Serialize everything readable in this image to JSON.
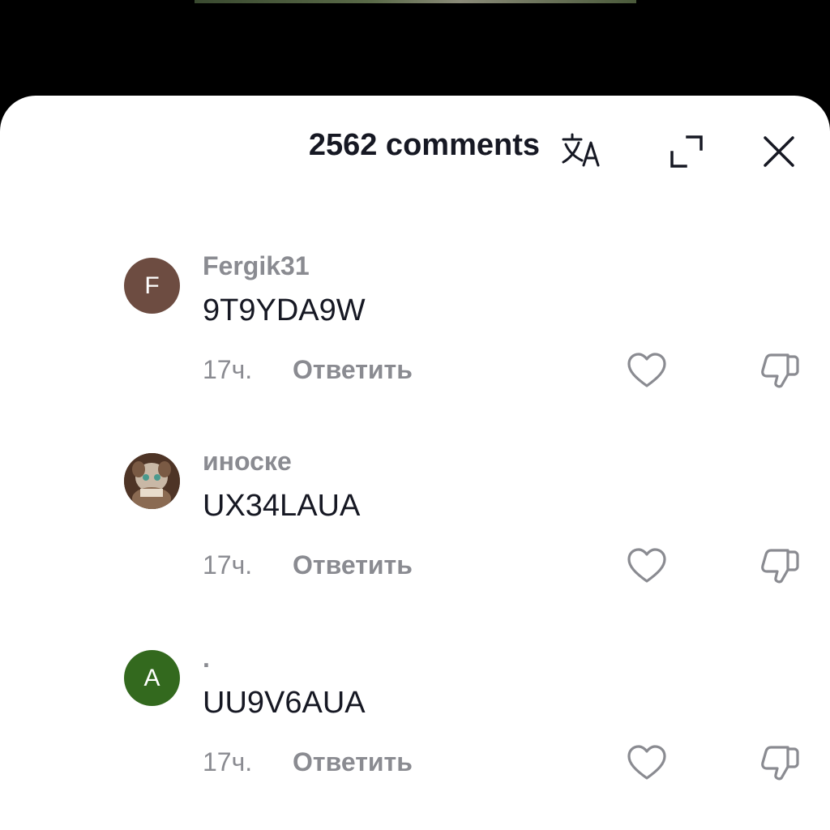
{
  "header": {
    "comments_count": "2562 comments",
    "icons": {
      "translate": "translate-icon",
      "expand": "expand-icon",
      "close": "close-icon"
    }
  },
  "comments": [
    {
      "username": "Fergik31",
      "text": "9T9YDA9W",
      "time": "17ч.",
      "reply_label": "Ответить",
      "avatar_letter": "F",
      "avatar_color": "#6d4c41",
      "avatar_type": "letter"
    },
    {
      "username": "иноске",
      "text": "UX34LAUA",
      "time": "17ч.",
      "reply_label": "Ответить",
      "avatar_type": "image"
    },
    {
      "username": ".",
      "text": "UU9V6AUA",
      "time": "17ч.",
      "reply_label": "Ответить",
      "avatar_letter": "A",
      "avatar_color": "#33691e",
      "avatar_type": "letter"
    }
  ],
  "colors": {
    "primary_text": "#161823",
    "secondary_text": "#8a8b91",
    "icon_gray": "#8a8b91",
    "header_icon": "#161823"
  }
}
